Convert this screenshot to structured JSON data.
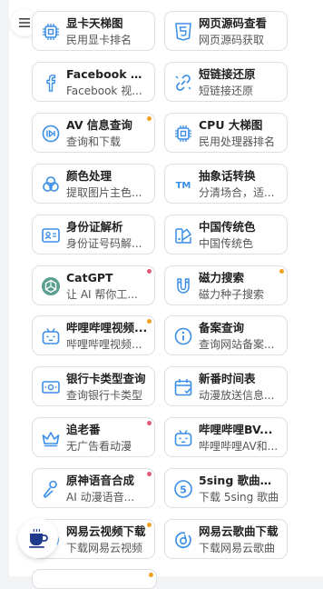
{
  "colors": {
    "dot_orange": "#f0a020",
    "dot_red": "#e05a78",
    "icon": "#3a8ee6",
    "border": "#dcdfe6"
  },
  "icons": {
    "menu": "menu-icon",
    "coffee": "coffee-icon"
  },
  "cards": [
    {
      "name": "gpu-ranking",
      "icon": "chip-icon",
      "title": "显卡天梯图",
      "subtitle": "民用显卡排名",
      "dot": ""
    },
    {
      "name": "page-source",
      "icon": "html5-icon",
      "title": "网页源码查看",
      "subtitle": "网页源码获取",
      "dot": ""
    },
    {
      "name": "facebook-video",
      "icon": "facebook-icon",
      "title": "Facebook 视...",
      "subtitle": "Facebook 视...",
      "dot": ""
    },
    {
      "name": "short-link-restore",
      "icon": "link-icon",
      "title": "短链接还原",
      "subtitle": "短链接还原",
      "dot": ""
    },
    {
      "name": "av-info",
      "icon": "av-icon",
      "title": "AV 信息查询",
      "subtitle": "查询和下载",
      "dot": "orange"
    },
    {
      "name": "cpu-ranking",
      "icon": "cpu-icon",
      "title": "CPU 大梯图",
      "subtitle": "民用处理器排名",
      "dot": ""
    },
    {
      "name": "color-process",
      "icon": "color-icon",
      "title": "颜色处理",
      "subtitle": "提取图片主色...",
      "dot": ""
    },
    {
      "name": "abstract-text",
      "icon": "tm-icon",
      "title": "抽象话转换",
      "subtitle": "分清场合，适...",
      "dot": ""
    },
    {
      "name": "id-parse",
      "icon": "id-card-icon",
      "title": "身份证解析",
      "subtitle": "身份证号码解...",
      "dot": ""
    },
    {
      "name": "chinese-colors",
      "icon": "palette-icon",
      "title": "中国传统色",
      "subtitle": "中国传统色",
      "dot": ""
    },
    {
      "name": "catgpt",
      "icon": "openai-icon",
      "title": "CatGPT",
      "subtitle": "让 AI 帮你工...",
      "dot": "red"
    },
    {
      "name": "magnet-search",
      "icon": "magnet-icon",
      "title": "磁力搜索",
      "subtitle": "磁力种子搜索",
      "dot": "orange"
    },
    {
      "name": "bilibili-video",
      "icon": "bilibili-icon",
      "title": "哔哩哔哩视频...",
      "subtitle": "哔哩哔哩视频...",
      "dot": "orange"
    },
    {
      "name": "icp-query",
      "icon": "info-icon",
      "title": "备案查询",
      "subtitle": "查询网站备案...",
      "dot": ""
    },
    {
      "name": "bank-card",
      "icon": "bank-card-icon",
      "title": "银行卡类型查询",
      "subtitle": "查询银行卡类型",
      "dot": ""
    },
    {
      "name": "anime-schedule",
      "icon": "calendar-icon",
      "title": "新番时间表",
      "subtitle": "动漫放送信息...",
      "dot": ""
    },
    {
      "name": "old-anime",
      "icon": "crown-icon",
      "title": "追老番",
      "subtitle": "无广告看动漫",
      "dot": "red"
    },
    {
      "name": "bilibili-bv",
      "icon": "bilibili-icon",
      "title": "哔哩哔哩BV...",
      "subtitle": "哔哩哔哩AV和...",
      "dot": ""
    },
    {
      "name": "genshin-voice",
      "icon": "microphone-icon",
      "title": "原神语音合成",
      "subtitle": "AI 动漫语音...",
      "dot": "red"
    },
    {
      "name": "5sing-download",
      "icon": "five-icon",
      "title": "5sing 歌曲下载",
      "subtitle": "下载 5sing 歌曲",
      "dot": ""
    },
    {
      "name": "netease-video",
      "icon": "netease-icon",
      "title": "网易云视频下载",
      "subtitle": "下载网易云视频",
      "dot": "orange"
    },
    {
      "name": "netease-song",
      "icon": "netease-icon",
      "title": "网易云歌曲下载",
      "subtitle": "下载网易云歌曲",
      "dot": ""
    }
  ]
}
